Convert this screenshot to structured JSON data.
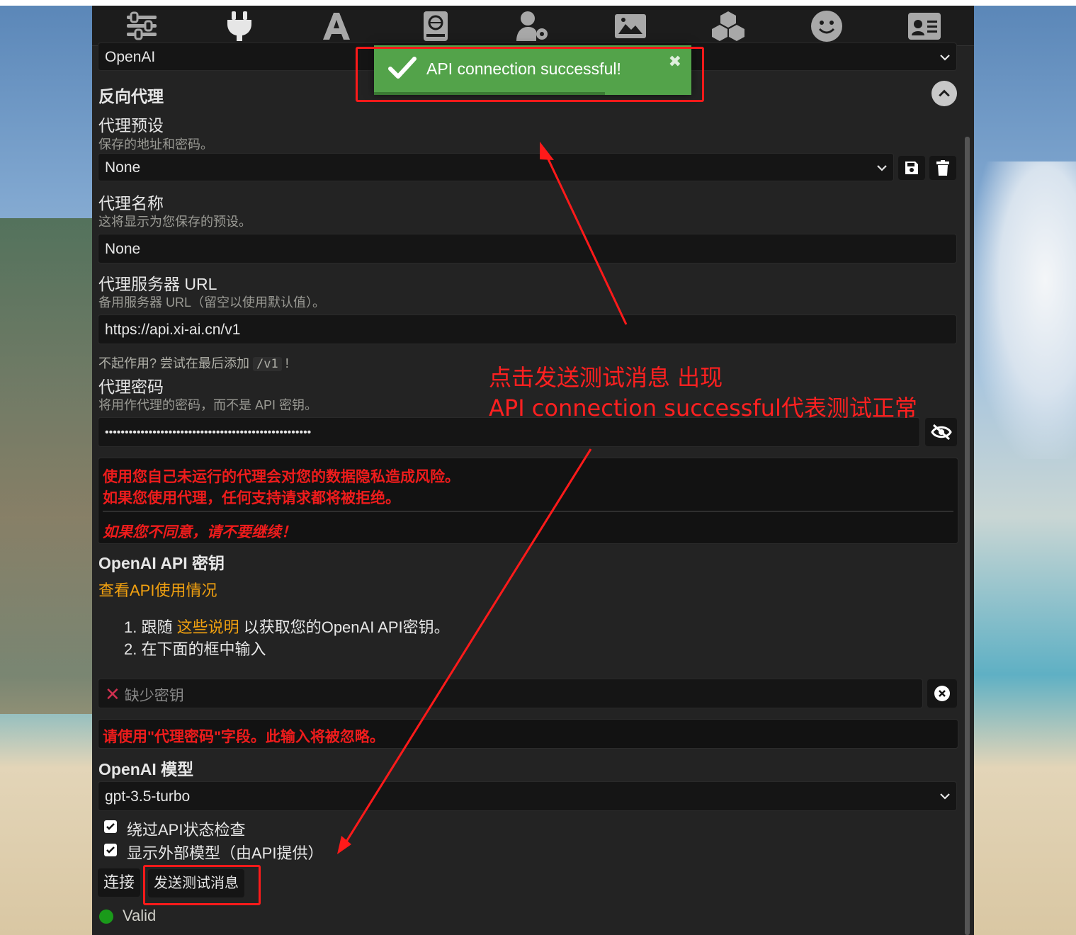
{
  "topbar": {
    "icons": [
      "sliders-icon",
      "plug-icon",
      "font-icon",
      "book-globe-icon",
      "user-gear-icon",
      "image-icon",
      "cubes-icon",
      "smiley-icon",
      "id-card-icon"
    ]
  },
  "api_source": {
    "selected": "OpenAI"
  },
  "toast": {
    "message": "API connection successful!",
    "close": "✖"
  },
  "reverse_proxy": {
    "section_title": "反向代理",
    "preset_label": "代理预设",
    "preset_desc": "保存的地址和密码。",
    "preset_value": "None",
    "name_label": "代理名称",
    "name_desc": "这将显示为您保存的预设。",
    "name_value": "None",
    "url_label": "代理服务器 URL",
    "url_desc": "备用服务器 URL（留空以使用默认值）。",
    "url_value": "https://api.xi-ai.cn/v1",
    "hint_prefix": "不起作用? 尝试在最后添加",
    "hint_code": "/v1",
    "hint_suffix": "!",
    "password_label": "代理密码",
    "password_desc": "将用作代理的密码，而不是 API 密钥。",
    "password_value": "••••••••••••••••••••••••••••••••••••••••••••••••••••",
    "warning_1": "使用您自己未运行的代理会对您的数据隐私造成风险。",
    "warning_2": "如果您使用代理，任何支持请求都将被拒绝。",
    "warning_3": "如果您不同意，请不要继续！"
  },
  "api_key": {
    "title": "OpenAI API 密钥",
    "usage_link": "查看API使用情况",
    "step1_prefix": "1. 跟随 ",
    "step1_link": "这些说明",
    "step1_suffix": " 以获取您的OpenAI API密钥。",
    "step2": "2. 在下面的框中输入",
    "missing_placeholder": "缺少密钥",
    "ignore_warning": "请使用\"代理密码\"字段。此输入将被忽略。"
  },
  "model": {
    "title": "OpenAI 模型",
    "selected": "gpt-3.5-turbo",
    "bypass_check": "绕过API状态检查",
    "show_external": "显示外部模型（由API提供）",
    "connect_button": "连接",
    "test_button": "发送测试消息",
    "status": "Valid"
  },
  "annotation": {
    "line1": "点击发送测试消息 出现",
    "line2": "API connection successful代表测试正常"
  },
  "colors": {
    "panel": "#232323",
    "toast": "#53a34a",
    "warning": "#ee1c1c",
    "link": "#f0a010",
    "annotation": "#ff2020",
    "status_ok": "#1a9a1a"
  }
}
